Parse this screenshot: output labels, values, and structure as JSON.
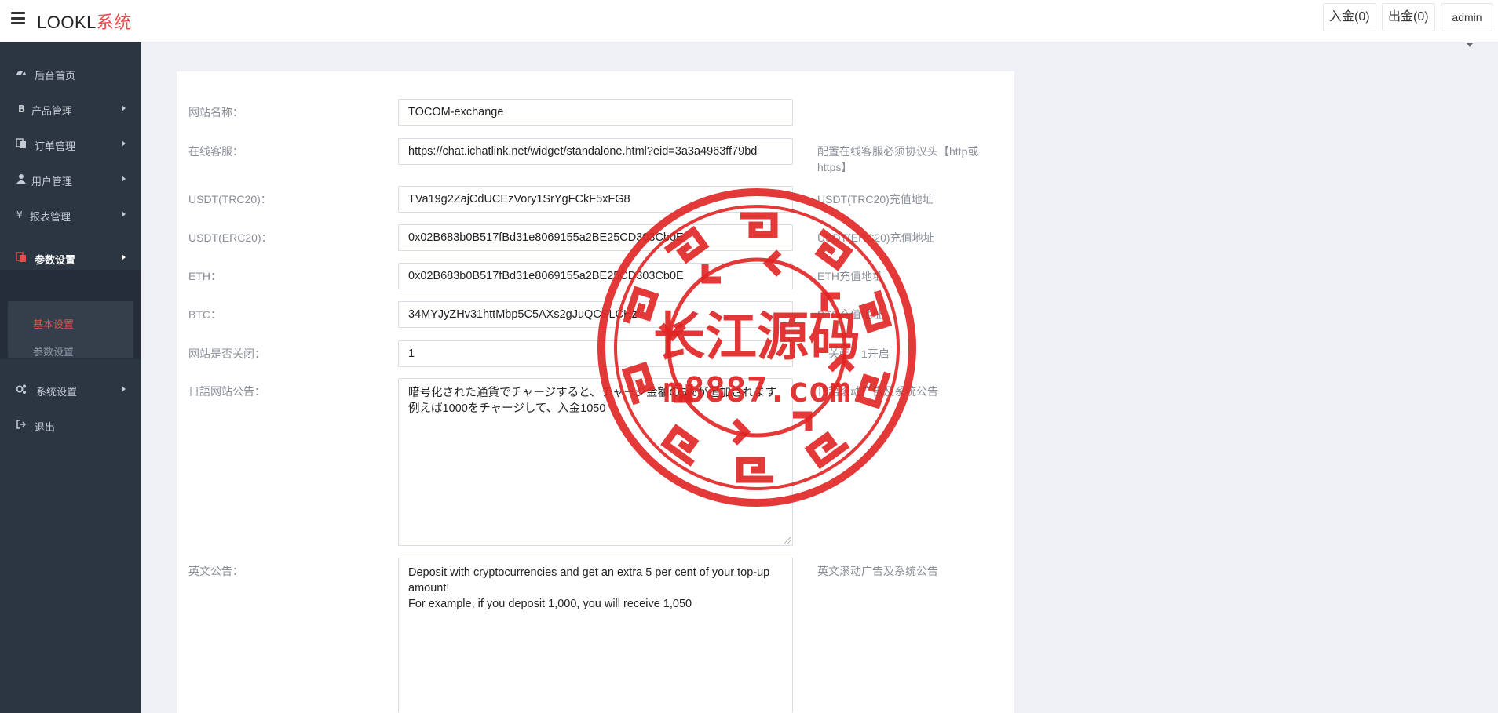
{
  "app": {
    "brand_prefix": "LOOKL",
    "brand_suffix": "系统"
  },
  "header": {
    "deposit_label": "入金(0)",
    "withdraw_label": "出金(0)",
    "user_label": "admin"
  },
  "sidebar": {
    "items": [
      {
        "label": "后台首页",
        "icon": "dashboard-icon"
      },
      {
        "label": "产品管理",
        "icon": "bitcoin-icon"
      },
      {
        "label": "订单管理",
        "icon": "copy-icon"
      },
      {
        "label": "用户管理",
        "icon": "user-icon"
      },
      {
        "label": "报表管理",
        "icon": "yen-icon"
      },
      {
        "label": "参数设置",
        "icon": "files-icon"
      },
      {
        "label": "系统设置",
        "icon": "cogs-icon"
      },
      {
        "label": "退出",
        "icon": "sign-out-icon"
      }
    ],
    "subitems": [
      {
        "label": "基本设置"
      },
      {
        "label": "参数设置"
      }
    ],
    "active_color": "#e84c4c"
  },
  "form": {
    "fields": [
      {
        "label": "网站名称：",
        "value": "TOCOM-exchange",
        "hint": ""
      },
      {
        "label": "在线客服：",
        "value": "https://chat.ichatlink.net/widget/standalone.html?eid=3a3a4963ff79bd",
        "hint": "配置在线客服必须协议头【http或https】"
      },
      {
        "label": "USDT(TRC20)：",
        "value": "TVa19g2ZajCdUCEzVory1SrYgFCkF5xFG8",
        "hint": "USDT(TRC20)充值地址"
      },
      {
        "label": "USDT(ERC20)：",
        "value": "0x02B683b0B517fBd31e8069155a2BE25CD303Cb0E",
        "hint": "USDT(ERC20)充值地址"
      },
      {
        "label": "ETH：",
        "value": "0x02B683b0B517fBd31e8069155a2BE25CD303Cb0E",
        "hint": "ETH充值地址"
      },
      {
        "label": "BTC：",
        "value": "34MYJyZHv31httMbp5C5AXs2gJuQCSLCHz",
        "hint": "BTC充值地址"
      },
      {
        "label": "网站是否关闭：",
        "value": "1",
        "hint": "关闭，1开启"
      },
      {
        "label": "日語网站公告：",
        "value": "暗号化された通貨でチャージすると、チャージ金額の5%が追加されます例えば1000をチャージして、入金1050",
        "hint": "日語滚动广告及系统公告"
      },
      {
        "label": "英文公告：",
        "value": "Deposit with cryptocurrencies and get an extra 5 per cent of your top-up amount!\nFor example, if you deposit 1,000, you will receive 1,050",
        "hint": "英文滚动广告及系统公告"
      }
    ]
  },
  "watermark": {
    "title": "长江源码",
    "url": "m8887.com",
    "color": "#e02424"
  }
}
